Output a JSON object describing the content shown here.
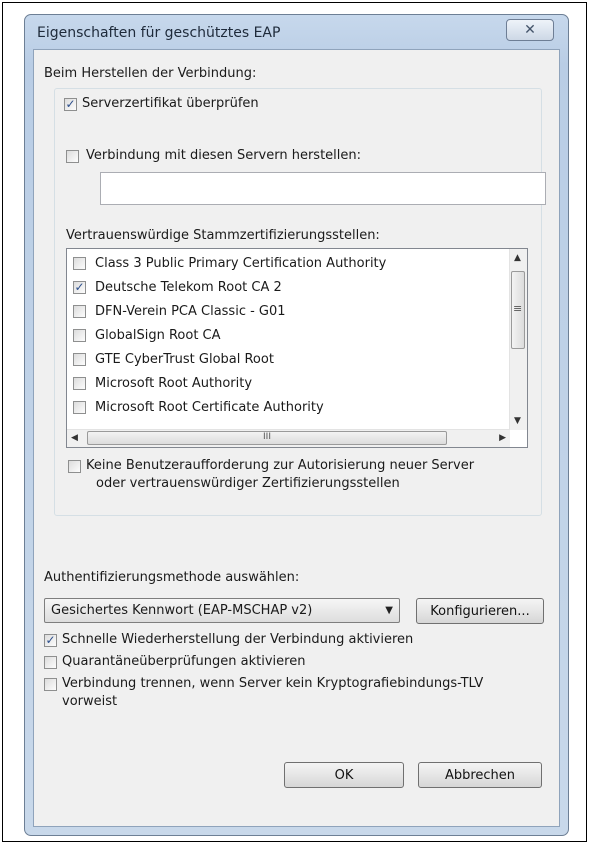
{
  "window": {
    "title": "Eigenschaften für geschütztes EAP",
    "close_glyph": "✕"
  },
  "connect_section": {
    "heading": "Beim Herstellen der Verbindung:",
    "verify_cert": {
      "label": "Serverzertifikat überprüfen",
      "checked": true
    },
    "connect_servers": {
      "label": "Verbindung mit diesen Servern herstellen:",
      "checked": false,
      "value": ""
    },
    "trusted_roots_label": "Vertrauenswürdige Stammzertifizierungsstellen:",
    "trusted_roots": [
      {
        "label": "Class 3 Public Primary Certification Authority",
        "checked": false
      },
      {
        "label": "Deutsche Telekom Root CA 2",
        "checked": true
      },
      {
        "label": "DFN-Verein PCA Classic - G01",
        "checked": false
      },
      {
        "label": "GlobalSign Root CA",
        "checked": false
      },
      {
        "label": "GTE CyberTrust Global Root",
        "checked": false
      },
      {
        "label": "Microsoft Root Authority",
        "checked": false
      },
      {
        "label": "Microsoft Root Certificate Authority",
        "checked": false
      }
    ],
    "no_prompt": {
      "label_line1": "Keine Benutzeraufforderung zur Autorisierung neuer Server",
      "label_line2": "oder vertrauenswürdiger Zertifizierungsstellen",
      "checked": false
    }
  },
  "auth": {
    "heading": "Authentifizierungsmethode auswählen:",
    "selected_method": "Gesichertes Kennwort (EAP-MSCHAP v2)",
    "configure_label": "Konfigurieren..."
  },
  "options": [
    {
      "label": "Schnelle Wiederherstellung der Verbindung aktivieren",
      "checked": true
    },
    {
      "label": "Quarantäneüberprüfungen aktivieren",
      "checked": false
    },
    {
      "label_line1": "Verbindung trennen, wenn Server kein Kryptografiebindungs-TLV",
      "label_line2": "vorweist",
      "checked": false
    }
  ],
  "buttons": {
    "ok": "OK",
    "cancel": "Abbrechen"
  },
  "scroll_glyphs": {
    "up": "▲",
    "down": "▼",
    "left": "◀",
    "right": "▶",
    "grip_v": "≡",
    "grip_h": "III"
  },
  "check_glyph": "✓"
}
